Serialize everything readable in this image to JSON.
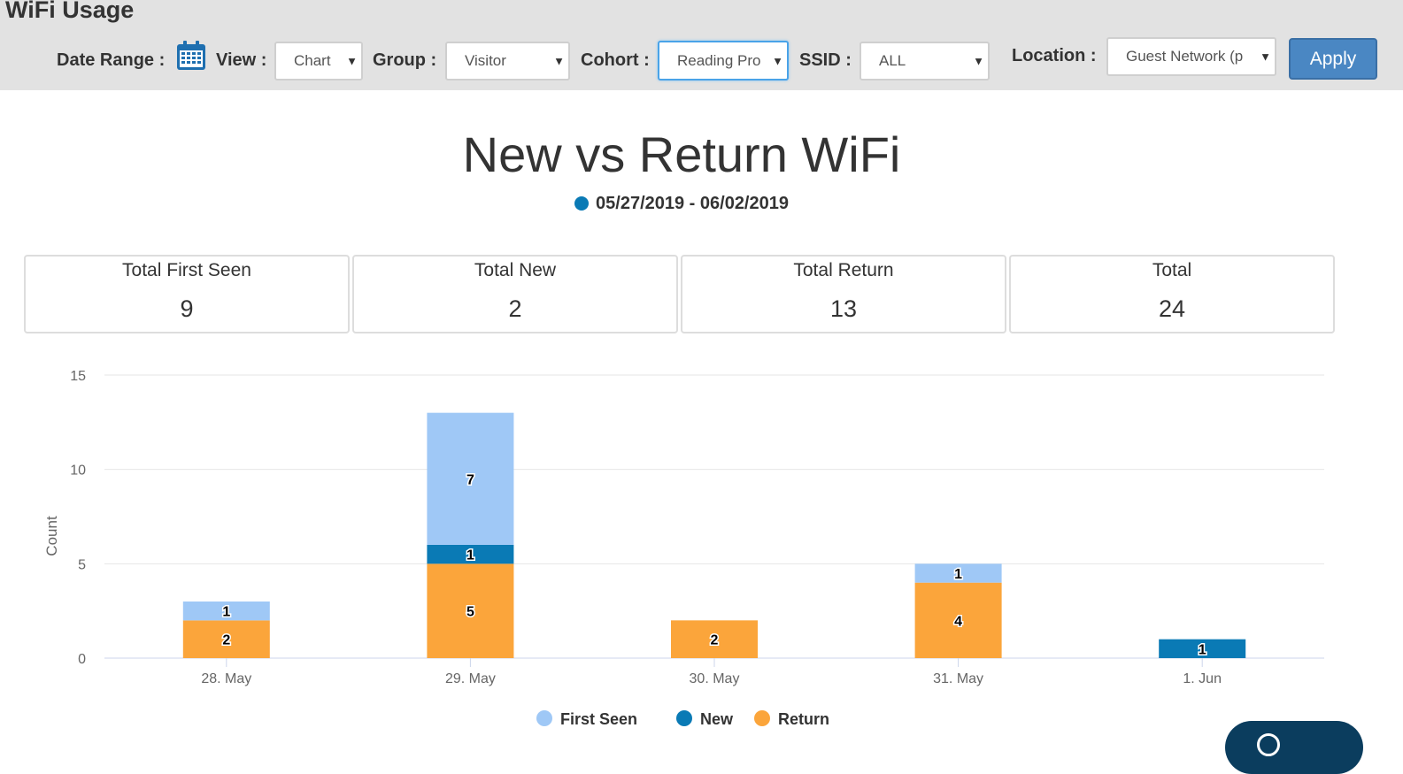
{
  "app_title": "WiFi Usage",
  "filters": {
    "date_range_label": "Date Range :",
    "view_label": "View :",
    "view_value": "Chart",
    "group_label": "Group :",
    "group_value": "Visitor",
    "cohort_label": "Cohort :",
    "cohort_value": "Reading Pro",
    "ssid_label": "SSID :",
    "ssid_value": "ALL",
    "location_label": "Location :",
    "location_value": "Guest Network (p",
    "apply_label": "Apply"
  },
  "icons": {
    "calendar": "calendar-icon",
    "dropdown": "chevron-down-icon"
  },
  "chart_header": {
    "title": "New vs Return WiFi",
    "date_range": "05/27/2019 - 06/02/2019"
  },
  "stats": [
    {
      "label": "Total First Seen",
      "value": "9"
    },
    {
      "label": "Total New",
      "value": "2"
    },
    {
      "label": "Total Return",
      "value": "13"
    },
    {
      "label": "Total",
      "value": "24"
    }
  ],
  "colors": {
    "first_seen": "#9fc8f6",
    "new": "#0a7ab5",
    "return": "#fba53b",
    "apply": "#4a87c3",
    "topbar": "#e2e2e2"
  },
  "chart_data": {
    "type": "bar",
    "stacked": true,
    "categories": [
      "28. May",
      "29. May",
      "30. May",
      "31. May",
      "1. Jun"
    ],
    "series": [
      {
        "name": "Return",
        "values": [
          2,
          5,
          2,
          4,
          0
        ]
      },
      {
        "name": "New",
        "values": [
          0,
          1,
          0,
          0,
          1
        ]
      },
      {
        "name": "First Seen",
        "values": [
          1,
          7,
          0,
          1,
          0
        ]
      }
    ],
    "legend": [
      "First Seen",
      "New",
      "Return"
    ],
    "ylabel": "Count",
    "ylim": [
      0,
      15
    ],
    "yticks": [
      0,
      5,
      10,
      15
    ],
    "grid": true,
    "data_labels": true,
    "legend_position": "bottom-center"
  }
}
